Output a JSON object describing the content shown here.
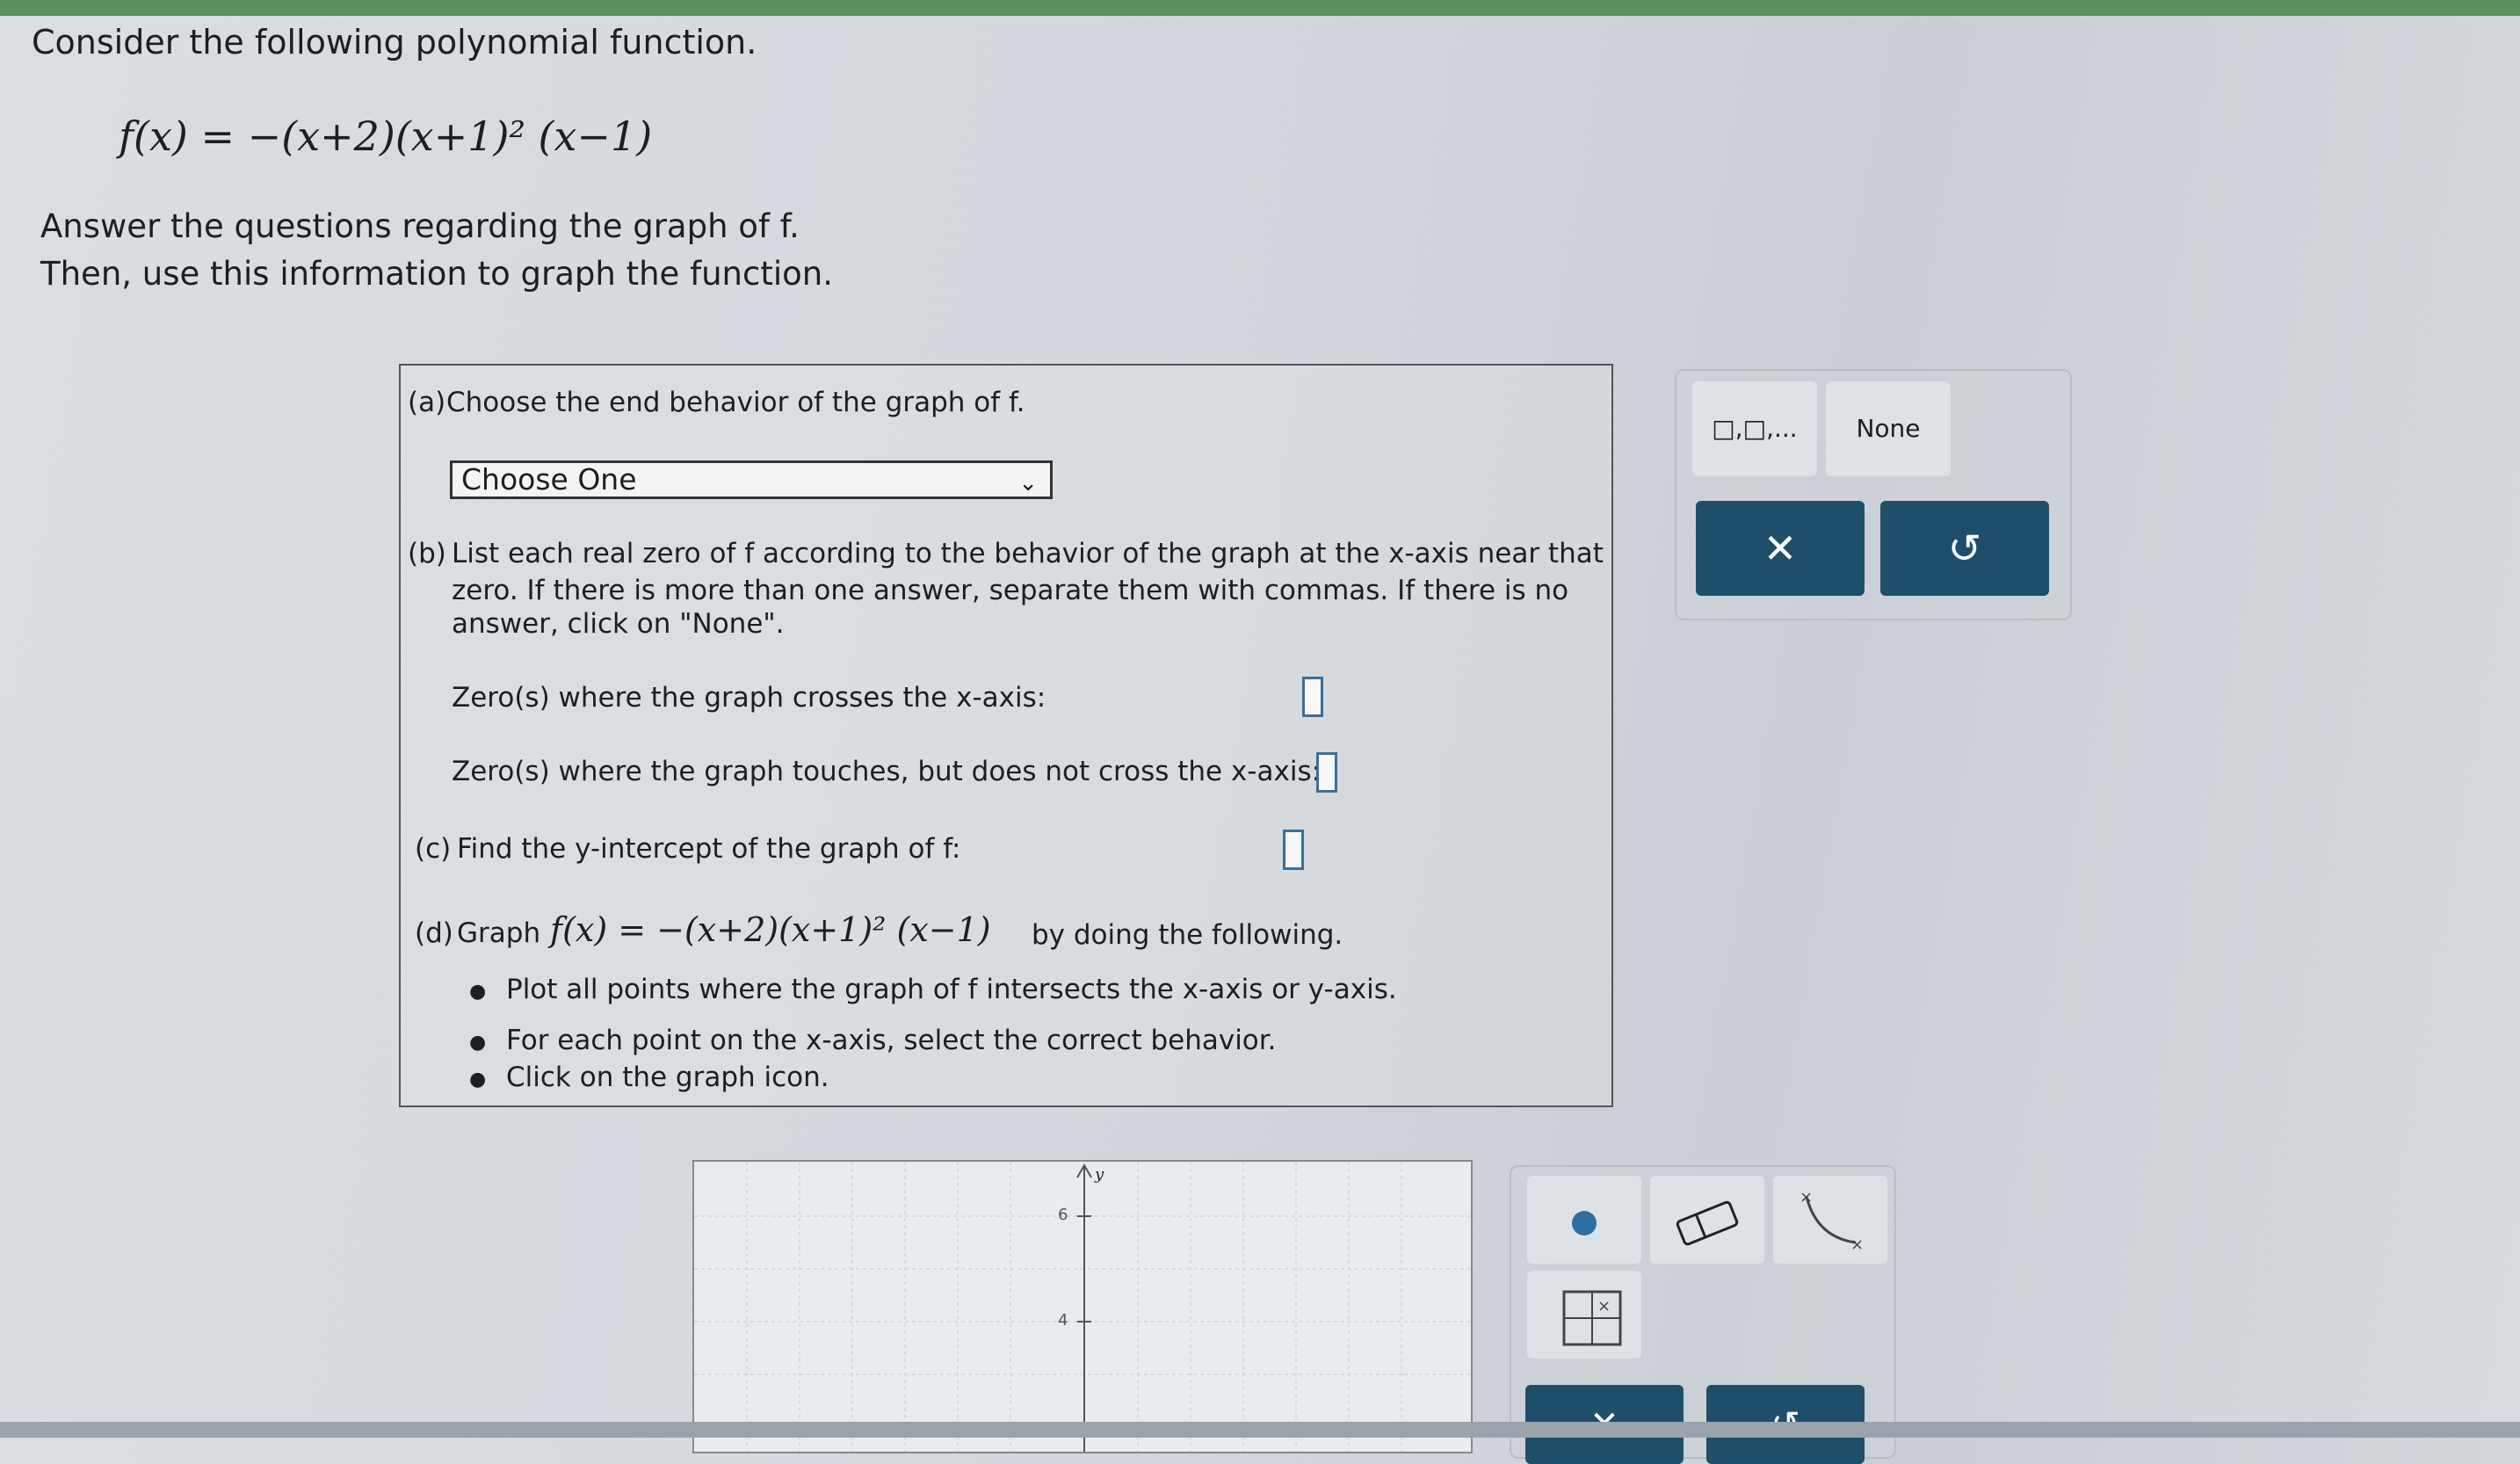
{
  "intro": "Consider the following polynomial function.",
  "formula": "f(x) = −(x+2)(x+1)² (x−1)",
  "instructions": {
    "line1": "Answer the questions regarding the graph of f.",
    "line2": "Then, use this information to graph the function."
  },
  "part_a": {
    "label": "(a)",
    "text": "Choose the end behavior of the graph of f.",
    "select_value": "Choose One"
  },
  "part_b": {
    "label": "(b)",
    "line1": "List each real zero of f according to the behavior of the graph at the x-axis near that",
    "line2": "zero. If there is more than one answer, separate them with commas. If there is no",
    "line3": "answer, click on \"None\".",
    "crosses_label": "Zero(s) where the graph crosses the x-axis:",
    "touches_label": "Zero(s) where the graph touches, but does not cross the x-axis:"
  },
  "part_c": {
    "label": "(c)",
    "text": "Find the y-intercept of the graph of f:"
  },
  "part_d": {
    "label": "(d)",
    "prefix": "Graph",
    "formula": "f(x) = −(x+2)(x+1)² (x−1)",
    "suffix": "by doing the following.",
    "bullets": [
      "Plot all points where the graph of f intersects the x-axis or y-axis.",
      "For each point on the x-axis, select the correct behavior.",
      "Click on the graph icon."
    ]
  },
  "tools": {
    "list_symbol": "□,□,...",
    "none_label": "None",
    "clear_symbol": "✕",
    "undo_symbol": "↺"
  },
  "graph": {
    "y_axis_label": "y",
    "tick_6": "6",
    "tick_4": "4"
  },
  "colors": {
    "dark_button": "#1f4e6b",
    "answer_box_border": "#3a6f9a",
    "point_tool": "#2e6fa3"
  }
}
